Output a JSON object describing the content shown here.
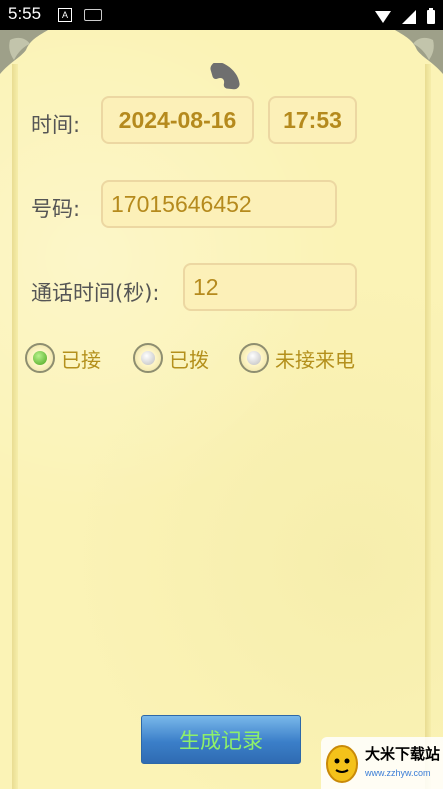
{
  "status_bar": {
    "time": "5:55",
    "notification_icon_letter": "A",
    "icons": [
      "a-notification-icon",
      "keyboard-icon",
      "wifi-icon",
      "signal-icon",
      "battery-icon"
    ]
  },
  "form": {
    "time_label": "时间:",
    "date_value": "2024-08-16",
    "time_value": "17:53",
    "number_label": "号码:",
    "number_value": "17015646452",
    "duration_label": "通话时间(秒):",
    "duration_value": "12"
  },
  "call_type": {
    "options": [
      {
        "label": "已接",
        "selected": true
      },
      {
        "label": "已拨",
        "selected": false
      },
      {
        "label": "未接来电",
        "selected": false
      }
    ]
  },
  "generate_button": "生成记录",
  "watermark": {
    "title": "大米下载站",
    "url": "www.zzhyw.com"
  },
  "colors": {
    "background": "#fbf3b6",
    "field_text": "#b58a1d",
    "label_text": "#555555",
    "radio_text": "#b4901c",
    "button_blue": "#3b7fc9",
    "button_text": "#8ef06a",
    "selected_radio": "#4aa51d"
  }
}
